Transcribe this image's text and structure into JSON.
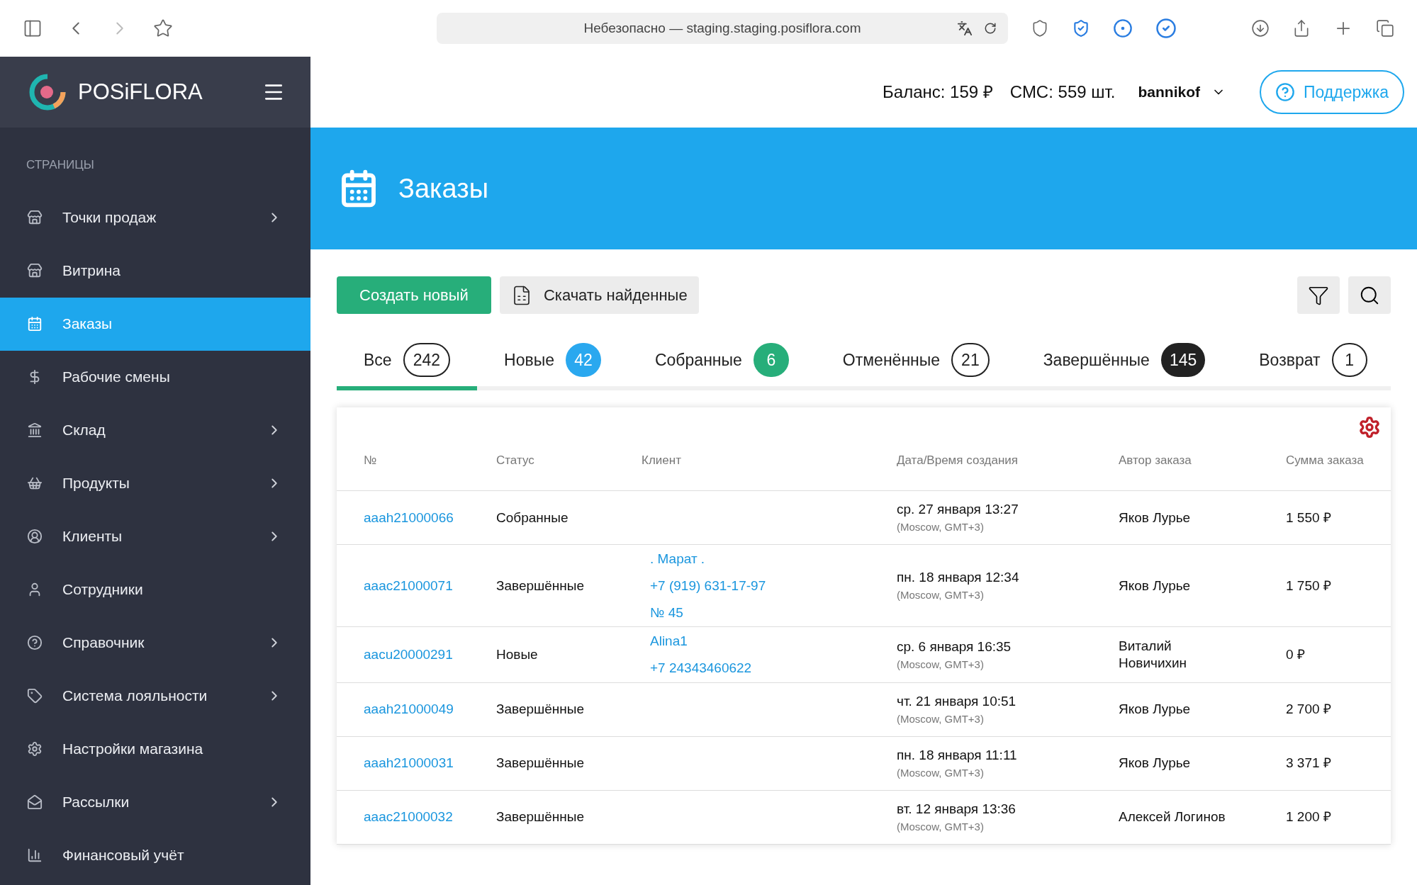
{
  "browser": {
    "address": "Небезопасно — staging.staging.posiflora.com"
  },
  "sidebar": {
    "logo": "POSiFLORA",
    "section": "СТРАНИЦЫ",
    "items": [
      {
        "label": "Точки продаж",
        "selected": false,
        "has_children": true
      },
      {
        "label": "Витрина",
        "selected": false,
        "has_children": false
      },
      {
        "label": "Заказы",
        "selected": true,
        "has_children": false
      },
      {
        "label": "Рабочие смены",
        "selected": false,
        "has_children": false
      },
      {
        "label": "Склад",
        "selected": false,
        "has_children": true
      },
      {
        "label": "Продукты",
        "selected": false,
        "has_children": true
      },
      {
        "label": "Клиенты",
        "selected": false,
        "has_children": true
      },
      {
        "label": "Сотрудники",
        "selected": false,
        "has_children": false
      },
      {
        "label": "Справочник",
        "selected": false,
        "has_children": true
      },
      {
        "label": "Система лояльности",
        "selected": false,
        "has_children": true
      },
      {
        "label": "Настройки магазина",
        "selected": false,
        "has_children": false
      },
      {
        "label": "Рассылки",
        "selected": false,
        "has_children": true
      },
      {
        "label": "Финансовый учёт",
        "selected": false,
        "has_children": false
      }
    ]
  },
  "header": {
    "balance": "Баланс: 159 ₽",
    "sms": "СМС: 559 шт.",
    "user": "bannikof",
    "support": "Поддержка"
  },
  "page": {
    "title": "Заказы"
  },
  "toolbar": {
    "create": "Создать новый",
    "download": "Скачать найденные"
  },
  "tabs": [
    {
      "label": "Все",
      "count": "242",
      "selected": true,
      "kind": "outline"
    },
    {
      "label": "Новые",
      "count": "42",
      "selected": false,
      "kind": "filled",
      "color": "#2aa8ef"
    },
    {
      "label": "Собранные",
      "count": "6",
      "selected": false,
      "kind": "filled",
      "color": "#27ae7a"
    },
    {
      "label": "Отменённые",
      "count": "21",
      "selected": false,
      "kind": "outline"
    },
    {
      "label": "Завершённые",
      "count": "145",
      "selected": false,
      "kind": "filled",
      "color": "#222222"
    },
    {
      "label": "Возврат",
      "count": "1",
      "selected": false,
      "kind": "outline"
    }
  ],
  "table": {
    "columns": [
      "№",
      "Статус",
      "Клиент",
      "Дата/Время создания",
      "Автор заказа",
      "Сумма заказа"
    ],
    "rows": [
      {
        "number": "aaah21000066",
        "status": "Собранные",
        "client": [],
        "date": "ср. 27 января 13:27",
        "timezone": "(Moscow, GMT+3)",
        "author": "Яков Лурье",
        "sum": "1 550 ₽"
      },
      {
        "number": "aaac21000071",
        "status": "Завершённые",
        "client": [
          ". Марат .",
          "+7 (919) 631-17-97",
          "№ 45"
        ],
        "date": "пн. 18 января 12:34",
        "timezone": "(Moscow, GMT+3)",
        "author": "Яков Лурье",
        "sum": "1 750 ₽"
      },
      {
        "number": "aacu20000291",
        "status": "Новые",
        "client": [
          "Alina1",
          "+7 24343460622"
        ],
        "date": "ср. 6 января 16:35",
        "timezone": "(Moscow, GMT+3)",
        "author": "Виталий Новичихин",
        "sum": "0 ₽"
      },
      {
        "number": "aaah21000049",
        "status": "Завершённые",
        "client": [],
        "date": "чт. 21 января 10:51",
        "timezone": "(Moscow, GMT+3)",
        "author": "Яков Лурье",
        "sum": "2 700 ₽"
      },
      {
        "number": "aaah21000031",
        "status": "Завершённые",
        "client": [],
        "date": "пн. 18 января 11:11",
        "timezone": "(Moscow, GMT+3)",
        "author": "Яков Лурье",
        "sum": "3 371 ₽"
      },
      {
        "number": "aaac21000032",
        "status": "Завершённые",
        "client": [],
        "date": "вт. 12 января 13:36",
        "timezone": "(Moscow, GMT+3)",
        "author": "Алексей Логинов",
        "sum": "1 200 ₽"
      }
    ]
  }
}
